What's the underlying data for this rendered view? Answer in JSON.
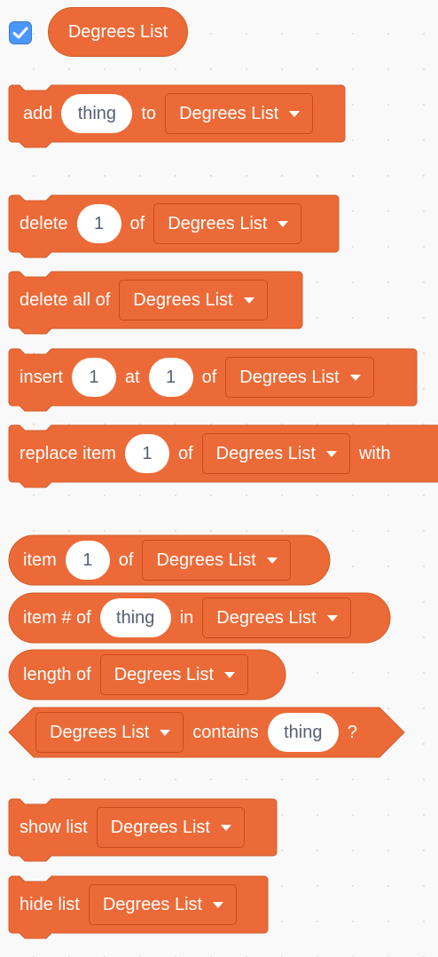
{
  "theme": {
    "block_fill": "#ec6a37",
    "block_stroke": "#cf5d2c",
    "dropdown_stroke": "#c94a1d",
    "input_text": "#575e75",
    "checkbox_fill": "#4c97ff"
  },
  "list_reporter": {
    "checked": true,
    "label": "Degrees List"
  },
  "blocks": {
    "add": {
      "w1": "add",
      "input": "thing",
      "w2": "to",
      "list": "Degrees List"
    },
    "delete": {
      "w1": "delete",
      "input": "1",
      "w2": "of",
      "list": "Degrees List"
    },
    "delete_all": {
      "w1": "delete all of",
      "list": "Degrees List"
    },
    "insert": {
      "w1": "insert",
      "input1": "1",
      "w2": "at",
      "input2": "1",
      "w3": "of",
      "list": "Degrees List"
    },
    "replace": {
      "w1": "replace item",
      "input": "1",
      "w2": "of",
      "list": "Degrees List",
      "w3": "with"
    },
    "item": {
      "w1": "item",
      "input": "1",
      "w2": "of",
      "list": "Degrees List"
    },
    "item_num": {
      "w1": "item # of",
      "input": "thing",
      "w2": "in",
      "list": "Degrees List"
    },
    "length": {
      "w1": "length of",
      "list": "Degrees List"
    },
    "contains": {
      "list": "Degrees List",
      "w1": "contains",
      "input": "thing",
      "w2": "?"
    },
    "show": {
      "w1": "show list",
      "list": "Degrees List"
    },
    "hide": {
      "w1": "hide list",
      "list": "Degrees List"
    }
  }
}
